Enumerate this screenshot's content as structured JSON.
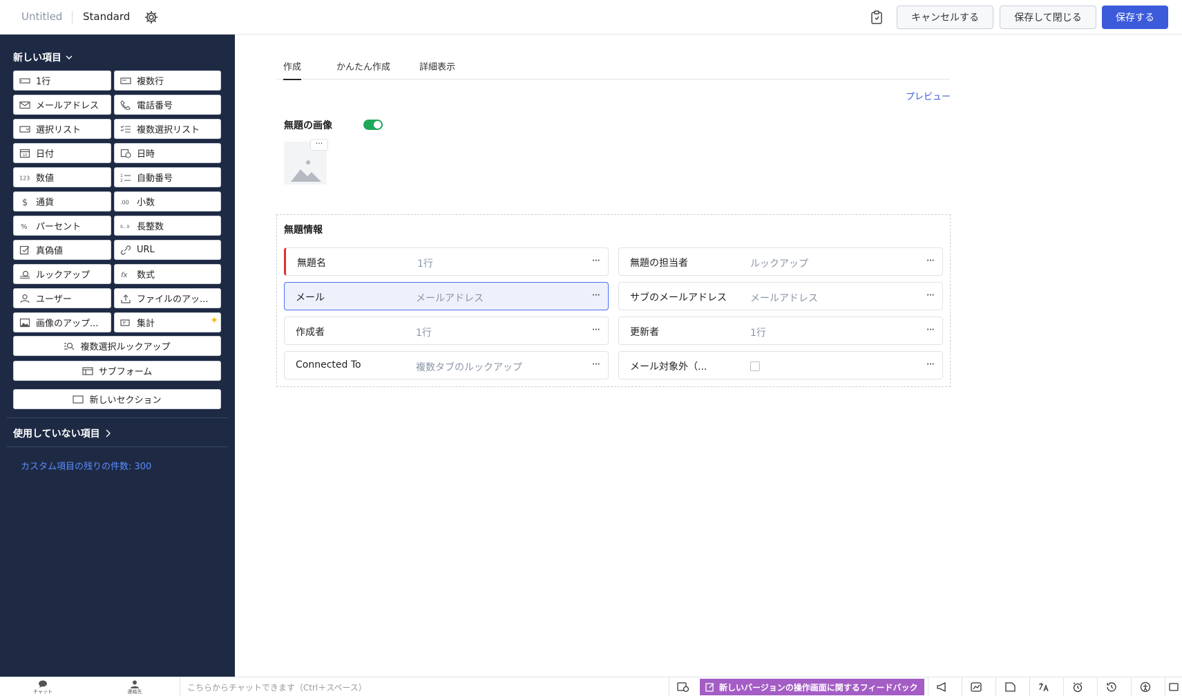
{
  "header": {
    "title": "Untitled",
    "layout_name": "Standard",
    "cancel_label": "キャンセルする",
    "save_close_label": "保存して閉じる",
    "save_label": "保存する"
  },
  "sidebar": {
    "new_items_label": "新しい項目",
    "field_buttons": [
      {
        "label": "1行",
        "icon": "single-line-icon"
      },
      {
        "label": "複数行",
        "icon": "multi-line-icon"
      },
      {
        "label": "メールアドレス",
        "icon": "email-icon"
      },
      {
        "label": "電話番号",
        "icon": "phone-icon"
      },
      {
        "label": "選択リスト",
        "icon": "picklist-icon"
      },
      {
        "label": "複数選択リスト",
        "icon": "multi-select-icon"
      },
      {
        "label": "日付",
        "icon": "date-icon"
      },
      {
        "label": "日時",
        "icon": "datetime-icon"
      },
      {
        "label": "数値",
        "icon": "number-icon"
      },
      {
        "label": "自動番号",
        "icon": "auto-number-icon"
      },
      {
        "label": "通貨",
        "icon": "currency-icon"
      },
      {
        "label": "小数",
        "icon": "decimal-icon"
      },
      {
        "label": "パーセント",
        "icon": "percent-icon"
      },
      {
        "label": "長整数",
        "icon": "long-integer-icon"
      },
      {
        "label": "真偽値",
        "icon": "boolean-icon"
      },
      {
        "label": "URL",
        "icon": "url-icon"
      },
      {
        "label": "ルックアップ",
        "icon": "lookup-icon"
      },
      {
        "label": "数式",
        "icon": "formula-icon"
      },
      {
        "label": "ユーザー",
        "icon": "user-icon"
      },
      {
        "label": "ファイルのアッ...",
        "icon": "file-upload-icon"
      },
      {
        "label": "画像のアップ...",
        "icon": "image-upload-icon"
      },
      {
        "label": "集計",
        "icon": "rollup-icon"
      }
    ],
    "multi_lookup_label": "複数選択ルックアップ",
    "subform_label": "サブフォーム",
    "new_section_label": "新しいセクション",
    "unused_items_label": "使用していない項目",
    "remaining_label": "カスタム項目の残りの件数: 300"
  },
  "main": {
    "tabs": [
      {
        "label": "作成",
        "active": true
      },
      {
        "label": "かんたん作成",
        "active": false
      },
      {
        "label": "詳細表示",
        "active": false
      }
    ],
    "preview_label": "プレビュー",
    "image_field_label": "無題の画像",
    "image_toggle_on": true,
    "section_title": "無題情報",
    "fields": [
      {
        "label": "無題名",
        "type": "1行",
        "required": true
      },
      {
        "label": "無題の担当者",
        "type": "ルックアップ"
      },
      {
        "label": "メール",
        "type": "メールアドレス",
        "selected": true
      },
      {
        "label": "サブのメールアドレス",
        "type": "メールアドレス"
      },
      {
        "label": "作成者",
        "type": "1行"
      },
      {
        "label": "更新者",
        "type": "1行"
      },
      {
        "label": "Connected To",
        "type": "複数タブのルックアップ"
      },
      {
        "label": "メール対象外（...",
        "type": "",
        "checkbox": true
      }
    ],
    "more_glyph": "···"
  },
  "bottombar": {
    "chat_label": "チャット",
    "contacts_label": "連絡先",
    "chat_placeholder": "こちらからチャットできます（Ctrl＋スペース）",
    "feedback_label": "新しいバージョンの操作画面に関するフィードバック"
  },
  "colors": {
    "sidebar_bg": "#1e2a44",
    "primary": "#3b5bdb",
    "toggle_on": "#1ea85a",
    "required": "#e03131",
    "feedback_bg": "#a45dc5"
  }
}
